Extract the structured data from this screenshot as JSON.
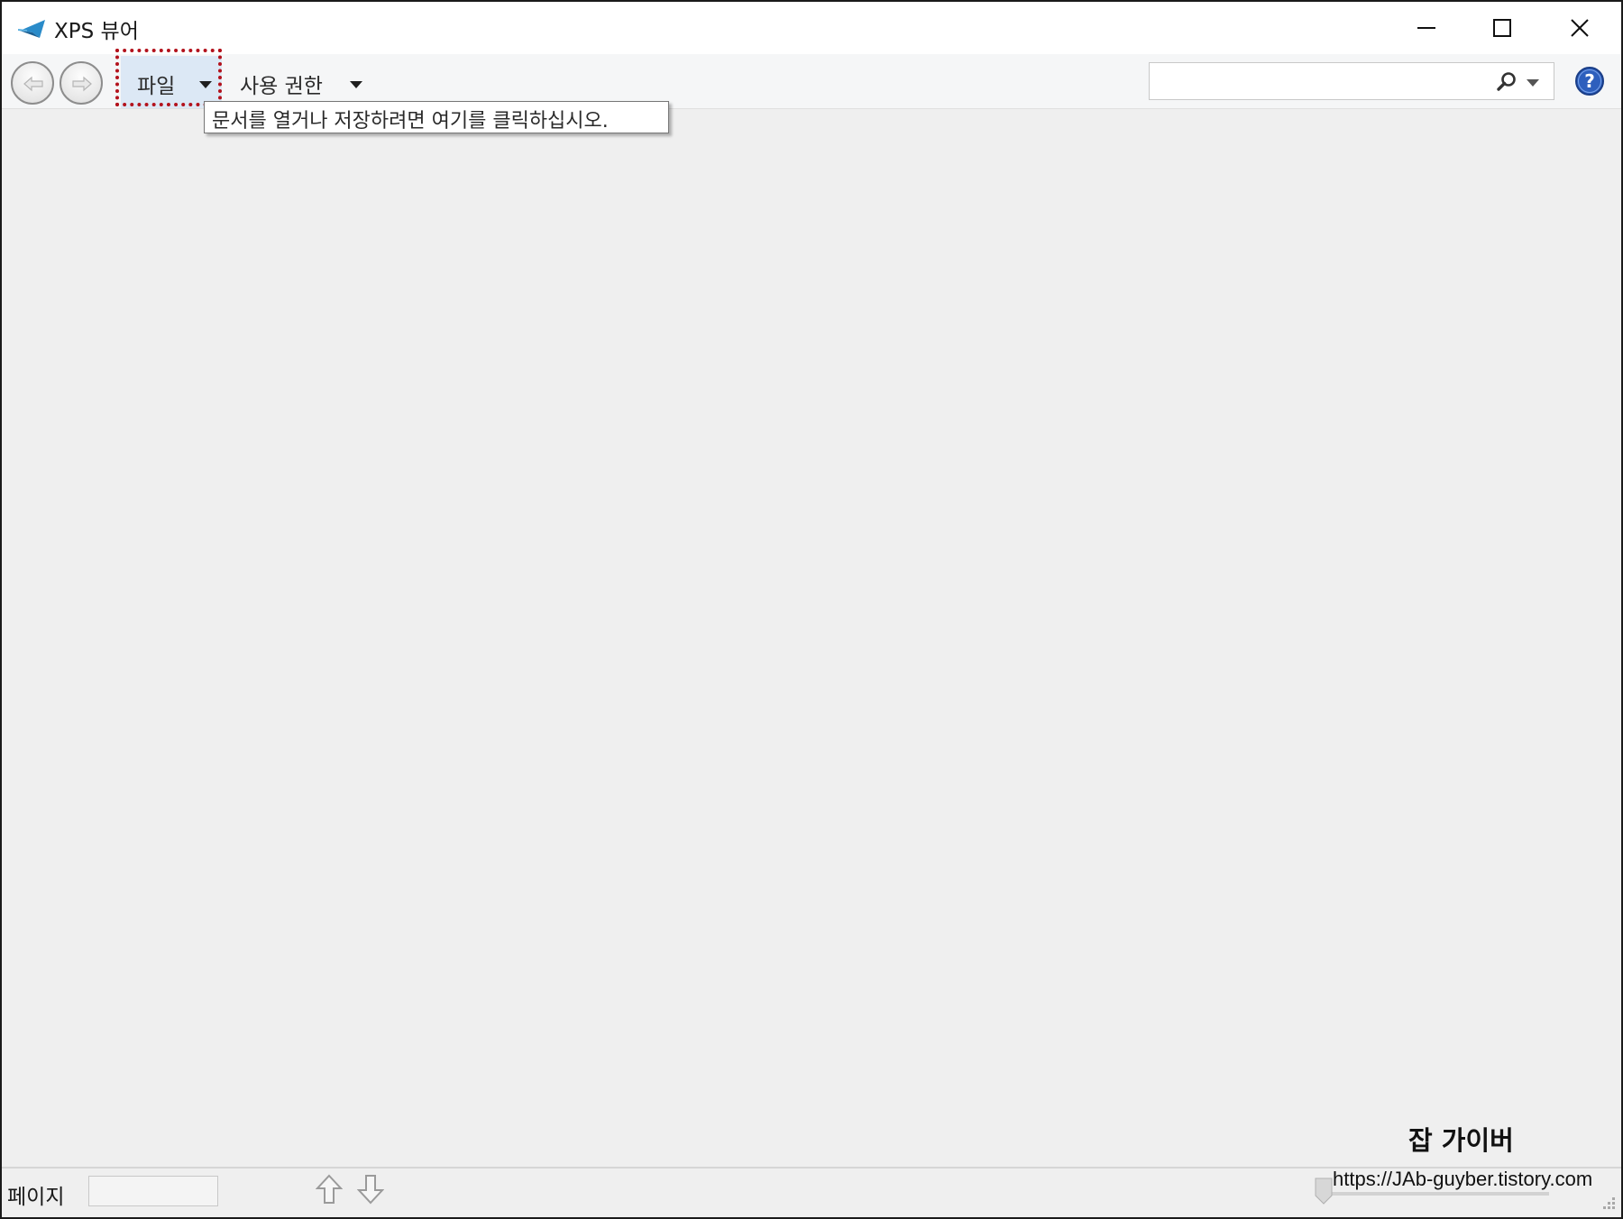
{
  "window": {
    "title": "XPS 뷰어",
    "icon": "xps-viewer-icon",
    "controls": [
      "minimize-icon",
      "maximize-icon",
      "close-icon"
    ]
  },
  "toolbar": {
    "nav": [
      "back-arrow-icon",
      "forward-arrow-icon"
    ],
    "file_menu_label": "파일",
    "permissions_menu_label": "사용 권한",
    "search": {
      "value": "",
      "icon": "search-icon"
    },
    "help_icon": "help-icon"
  },
  "tooltip": {
    "text": "문서를 열거나 저장하려면 여기를 클릭하십시오."
  },
  "statusbar": {
    "page_label": "페이지",
    "page_value": "",
    "up_icon": "page-up-arrow-icon",
    "down_icon": "page-down-arrow-icon"
  },
  "watermark": {
    "name": "잡 가이버",
    "url": "https://JAb-guyber.tistory.com"
  },
  "colors": {
    "highlight_border": "#b3121c",
    "menu_hover": "#dce8f5",
    "canvas": "#efefef"
  }
}
